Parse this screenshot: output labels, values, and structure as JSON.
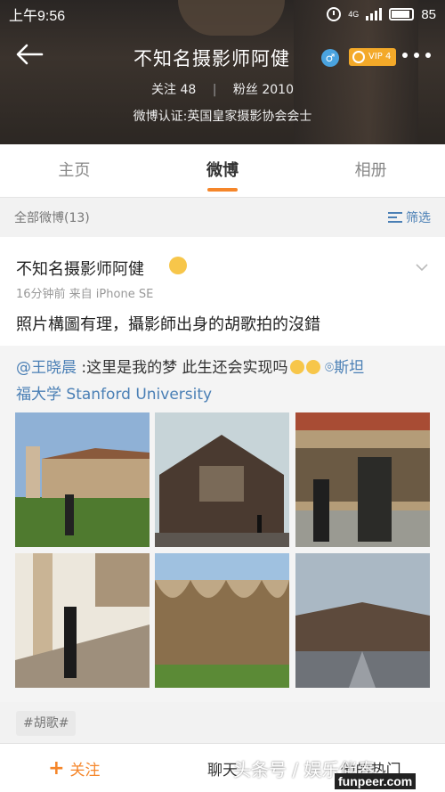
{
  "statusbar": {
    "time": "上午9:56",
    "network": "4G",
    "battery": "85"
  },
  "profile": {
    "name": "不知名摄影师阿健",
    "vip_label": "VIP 4",
    "follow_label": "关注",
    "follow_count": "48",
    "fans_label": "粉丝",
    "fans_count": "2010",
    "verification": "微博认证:英国皇家摄影协会会士"
  },
  "tabs": [
    {
      "label": "主页",
      "active": false
    },
    {
      "label": "微博",
      "active": true
    },
    {
      "label": "相册",
      "active": false
    }
  ],
  "filter_bar": {
    "all_weibo": "全部微博(13)",
    "filter_label": "筛选"
  },
  "post": {
    "author": "不知名摄影师阿健",
    "meta": "16分钟前  来自 iPhone SE",
    "text": "照片構圖有理，攝影師出身的胡歌拍的沒錯",
    "repost": {
      "mention": "@王晓晨",
      "text": " :这里是我的梦 此生还会实现吗",
      "location_line1": "斯坦",
      "location_line2": "福大学 Stanford University"
    },
    "tag": "#胡歌#"
  },
  "bottom_bar": {
    "follow": "关注",
    "chat": "聊天",
    "hot": "他的热门"
  },
  "watermarks": {
    "toutiao": "头条号 / 娱乐伴奏",
    "site": "funpeer.com"
  },
  "colors": {
    "accent": "#f5862a",
    "link": "#4a7fb5",
    "vip": "#f3a929"
  },
  "icons": [
    "back-arrow-icon",
    "gender-male-icon",
    "vip-crown-icon",
    "more-icon",
    "filter-icon",
    "chevron-down-icon",
    "location-icon",
    "plus-icon"
  ]
}
